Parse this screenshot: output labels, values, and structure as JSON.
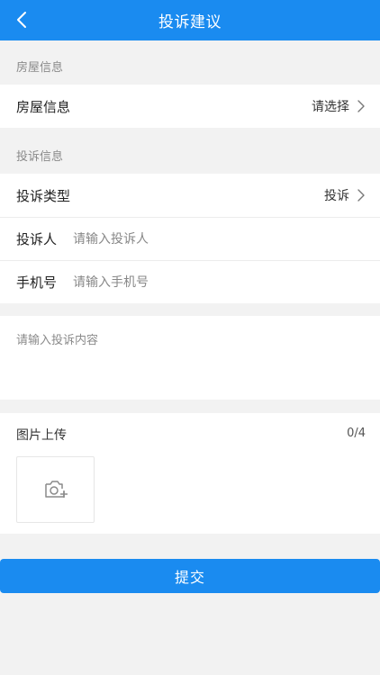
{
  "navbar": {
    "title": "投诉建议",
    "back_icon": "chevron-left-icon"
  },
  "house_section": {
    "header": "房屋信息",
    "row_label": "房屋信息",
    "row_value": "请选择"
  },
  "complaint_section": {
    "header": "投诉信息",
    "type_label": "投诉类型",
    "type_value": "投诉",
    "person_label": "投诉人",
    "person_placeholder": "请输入投诉人",
    "phone_label": "手机号",
    "phone_placeholder": "请输入手机号"
  },
  "content": {
    "placeholder": "请输入投诉内容"
  },
  "upload": {
    "title": "图片上传",
    "count": "0/4",
    "add_icon": "camera-add-icon"
  },
  "submit": {
    "label": "提交"
  },
  "colors": {
    "accent": "#1a8bf0",
    "background": "#f2f2f2"
  }
}
